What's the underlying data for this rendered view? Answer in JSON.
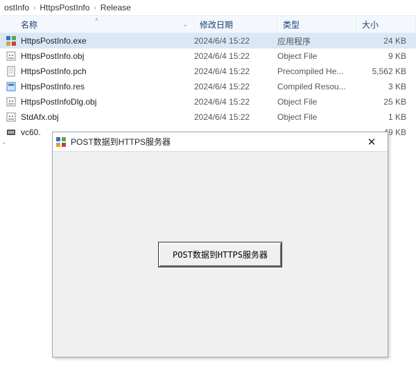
{
  "breadcrumb": {
    "items": [
      "ostInfo",
      "HttpsPostInfo",
      "Release"
    ]
  },
  "columns": {
    "name": "名称",
    "modified": "修改日期",
    "type": "类型",
    "size": "大小"
  },
  "files": [
    {
      "icon": "exe",
      "name": "HttpsPostInfo.exe",
      "date": "2024/6/4 15:22",
      "type": "应用程序",
      "size": "24 KB",
      "selected": true
    },
    {
      "icon": "obj",
      "name": "HttpsPostInfo.obj",
      "date": "2024/6/4 15:22",
      "type": "Object File",
      "size": "9 KB"
    },
    {
      "icon": "pch",
      "name": "HttpsPostInfo.pch",
      "date": "2024/6/4 15:22",
      "type": "Precompiled He...",
      "size": "5,562 KB"
    },
    {
      "icon": "res",
      "name": "HttpsPostInfo.res",
      "date": "2024/6/4 15:22",
      "type": "Compiled Resou...",
      "size": "3 KB"
    },
    {
      "icon": "obj",
      "name": "HttpsPostInfoDlg.obj",
      "date": "2024/6/4 15:22",
      "type": "Object File",
      "size": "25 KB"
    },
    {
      "icon": "obj",
      "name": "StdAfx.obj",
      "date": "2024/6/4 15:22",
      "type": "Object File",
      "size": "1 KB"
    },
    {
      "icon": "bin",
      "name": "vc60.",
      "date": "",
      "type": "",
      "size": "49 KB"
    }
  ],
  "dialog": {
    "title": "POST数据到HTTPS服务器",
    "button_label": "POST数据到HTTPS服务器"
  }
}
